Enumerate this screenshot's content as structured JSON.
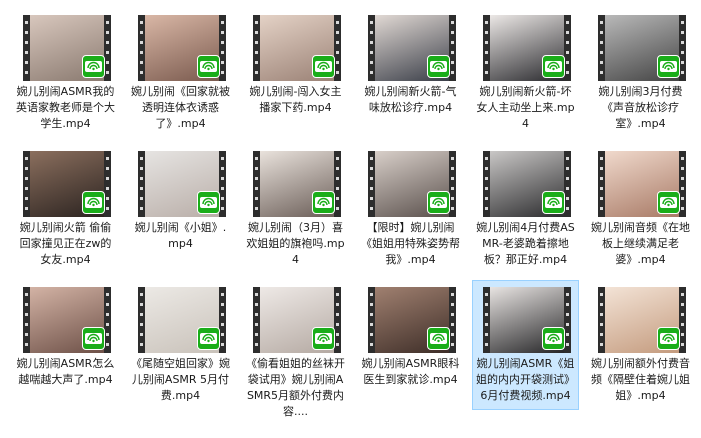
{
  "files": [
    {
      "name": "婉儿别闹ASMR我的英语家教老师是个大学生.mp4",
      "tone": [
        "#d8c7bd",
        "#8a7a70"
      ]
    },
    {
      "name": "婉儿别闹《回家就被透明连体衣诱惑了》.mp4",
      "tone": [
        "#d9b7a6",
        "#7a5a4e"
      ]
    },
    {
      "name": "婉儿别闹-闯入女主播家下药.mp4",
      "tone": [
        "#e4d2c6",
        "#9b8276"
      ]
    },
    {
      "name": "婉儿别闹新火箭-气味放松诊疗.mp4",
      "tone": [
        "#e1d9d4",
        "#3a3e48"
      ]
    },
    {
      "name": "婉儿别闹新火箭-坏女人主动坐上来.mp4",
      "tone": [
        "#ece8e6",
        "#2a2a2e"
      ]
    },
    {
      "name": "婉儿别闹3月付费《声音放松诊疗室》.mp4",
      "tone": [
        "#b9b9b9",
        "#444444"
      ]
    },
    {
      "name": "婉儿别闹火箭 偷偷回家撞见正在zw的女友.mp4",
      "tone": [
        "#8b6f5e",
        "#2b2320"
      ]
    },
    {
      "name": "婉儿别闹《小姐》.mp4",
      "tone": [
        "#e6e4e2",
        "#b9aea8"
      ]
    },
    {
      "name": "婉儿别闹（3月）喜欢姐姐的旗袍吗.mp4",
      "tone": [
        "#e9e2dc",
        "#6b5e58"
      ]
    },
    {
      "name": "【限时】婉儿别闹《姐姐用特殊姿势帮我》.mp4",
      "tone": [
        "#d8cfc9",
        "#5a504c"
      ]
    },
    {
      "name": "婉儿别闹4月付费ASMR-老婆跪着擦地板？那正好.mp4",
      "tone": [
        "#c9c7c6",
        "#2c2c2e"
      ]
    },
    {
      "name": "婉儿别闹音频《在地板上继续满足老婆》.mp4",
      "tone": [
        "#f0d9cc",
        "#a87a66"
      ]
    },
    {
      "name": "婉儿别闹ASMR怎么越喘越大声了.mp4",
      "tone": [
        "#d3b3a5",
        "#6e5148"
      ]
    },
    {
      "name": "《尾随空姐回家》婉儿别闹ASMR 5月付费.mp4",
      "tone": [
        "#ece9e5",
        "#c9c2ba"
      ]
    },
    {
      "name": "《偷看姐姐的丝袜开袋试用》婉儿别闹ASMR5月额外付费内容....",
      "tone": [
        "#eee9e6",
        "#b5aaa3"
      ]
    },
    {
      "name": "婉儿别闹ASMR眼科医生到家就诊.mp4",
      "tone": [
        "#a08070",
        "#3e2e28"
      ]
    },
    {
      "name": "婉儿别闹ASMR《姐姐的内内开袋测试》6月付费视频.mp4",
      "tone": [
        "#e8e4e2",
        "#262628"
      ]
    },
    {
      "name": "婉儿别闹额外付费音频《隔壁住着婉儿姐姐》.mp4",
      "tone": [
        "#f3e3d6",
        "#c49b7e"
      ]
    }
  ],
  "selected_index": 16,
  "badge_icon": "wechat-video-icon",
  "badge_color": "#1aad19"
}
